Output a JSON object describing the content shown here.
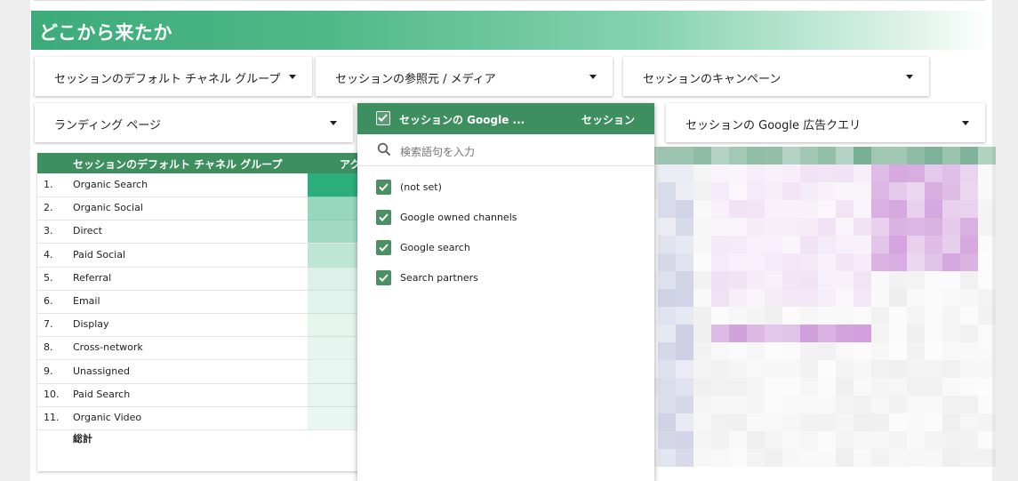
{
  "header": {
    "title": "どこから来たか"
  },
  "filters": [
    {
      "label": "セッションのデフォルト チャネル グループ"
    },
    {
      "label": "セッションの参照元 / メディア"
    },
    {
      "label": "セッションのキャンペーン"
    },
    {
      "label": "ランディング ページ"
    },
    {
      "label": "セッションの Google 広告クエリ"
    }
  ],
  "table": {
    "col_channel": "セッションのデフォルト チャネル グループ",
    "col_metric": "アク",
    "rows": [
      {
        "num": "1.",
        "name": "Organic Search",
        "level": 1.0
      },
      {
        "num": "2.",
        "name": "Organic Social",
        "level": 0.45
      },
      {
        "num": "3.",
        "name": "Direct",
        "level": 0.4
      },
      {
        "num": "4.",
        "name": "Paid Social",
        "level": 0.25
      },
      {
        "num": "5.",
        "name": "Referral",
        "level": 0.1
      },
      {
        "num": "6.",
        "name": "Email",
        "level": 0.06
      },
      {
        "num": "7.",
        "name": "Display",
        "level": 0.05
      },
      {
        "num": "8.",
        "name": "Cross-network",
        "level": 0.04
      },
      {
        "num": "9.",
        "name": "Unassigned",
        "level": 0.03
      },
      {
        "num": "10.",
        "name": "Paid Search",
        "level": 0.03
      },
      {
        "num": "11.",
        "name": "Organic Video",
        "level": 0.02
      }
    ],
    "total_label": "総計"
  },
  "dropdown": {
    "header_label": "セッションの Google ...",
    "header_metric": "セッション",
    "search_placeholder": "検索語句を入力",
    "options": [
      {
        "label": "(not set)",
        "checked": true
      },
      {
        "label": "Google owned channels",
        "checked": true
      },
      {
        "label": "Google search",
        "checked": true
      },
      {
        "label": "Search partners",
        "checked": true
      }
    ]
  },
  "colors": {
    "accent_green": "#3e8f5f",
    "header_gradient_start": "#3cab7a",
    "heat_purple": "#c98fd6",
    "heat_blue": "#b7bbd8"
  }
}
